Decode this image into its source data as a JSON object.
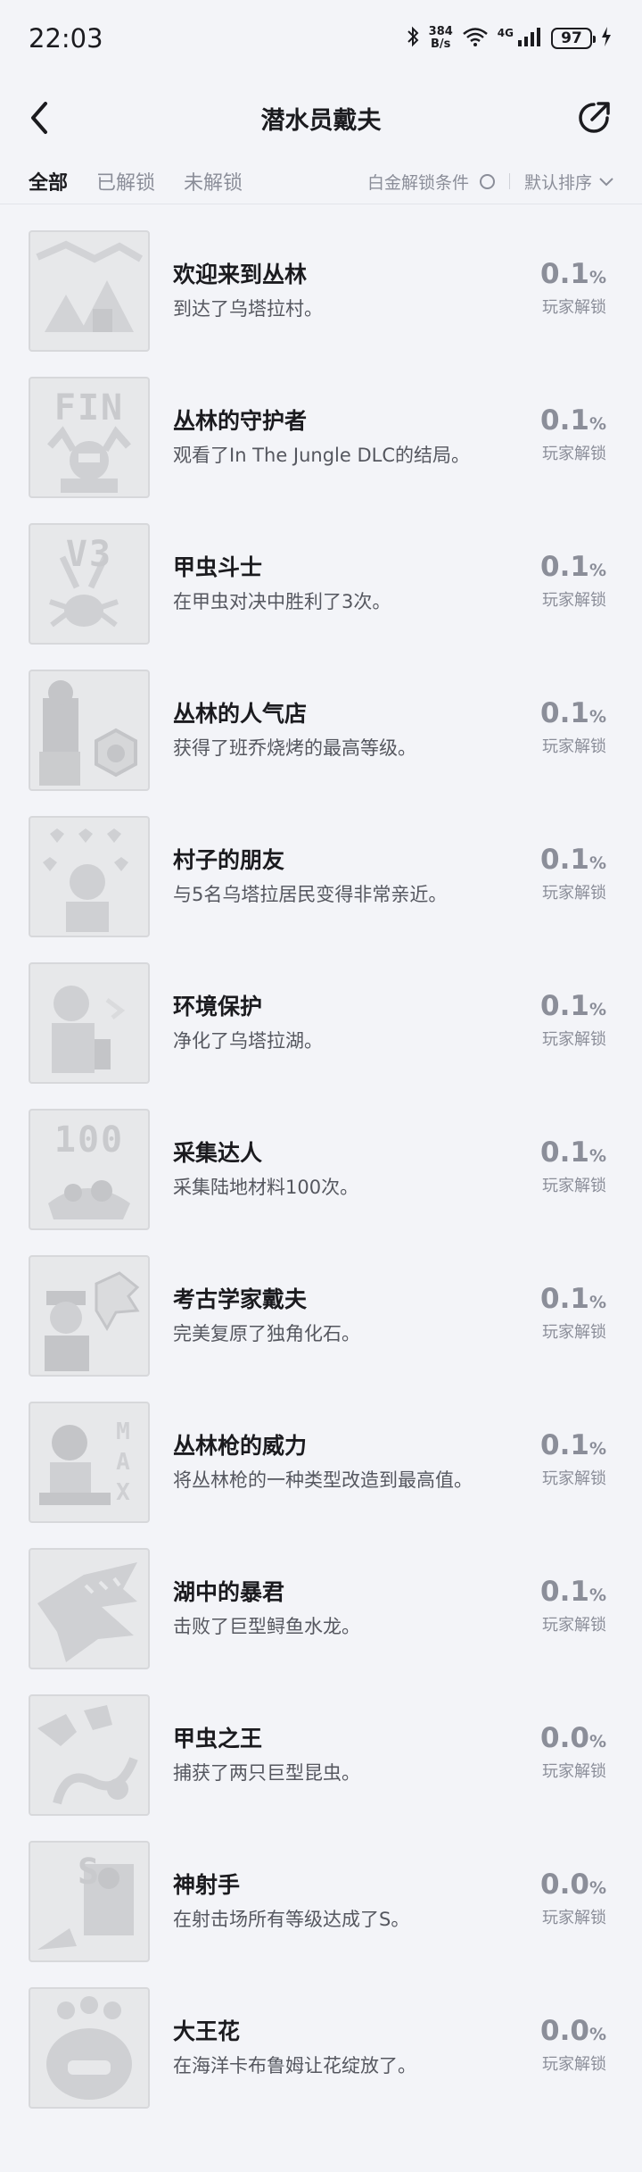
{
  "status_bar": {
    "time": "22:03",
    "speed_value": "384",
    "speed_unit": "B/s",
    "network": "4G",
    "battery": "97"
  },
  "header": {
    "title": "潜水员戴夫"
  },
  "filters": {
    "tabs": [
      "全部",
      "已解锁",
      "未解锁"
    ],
    "active_tab": "全部",
    "platinum_label": "白金解锁条件",
    "sort_label": "默认排序"
  },
  "unlock_label": "玩家解锁",
  "achievements": [
    {
      "name": "欢迎来到丛林",
      "desc": "到达了乌塔拉村。",
      "pct": "0.1",
      "icon": "village-icon",
      "badge": ""
    },
    {
      "name": "丛林的守护者",
      "desc": "观看了In The Jungle DLC的结局。",
      "pct": "0.1",
      "icon": "fin-guardian-icon",
      "badge": "FIN"
    },
    {
      "name": "甲虫斗士",
      "desc": "在甲虫对决中胜利了3次。",
      "pct": "0.1",
      "icon": "beetle-v3-icon",
      "badge": "V3"
    },
    {
      "name": "丛林的人气店",
      "desc": "获得了班乔烧烤的最高等级。",
      "pct": "0.1",
      "icon": "shop-level-icon",
      "badge": ""
    },
    {
      "name": "村子的朋友",
      "desc": "与5名乌塔拉居民变得非常亲近。",
      "pct": "0.1",
      "icon": "hearts-friend-icon",
      "badge": ""
    },
    {
      "name": "环境保护",
      "desc": "净化了乌塔拉湖。",
      "pct": "0.1",
      "icon": "environment-icon",
      "badge": ""
    },
    {
      "name": "采集达人",
      "desc": "采集陆地材料100次。",
      "pct": "0.1",
      "icon": "gather-100-icon",
      "badge": "100"
    },
    {
      "name": "考古学家戴夫",
      "desc": "完美复原了独角化石。",
      "pct": "0.1",
      "icon": "archaeologist-icon",
      "badge": ""
    },
    {
      "name": "丛林枪的威力",
      "desc": "将丛林枪的一种类型改造到最高值。",
      "pct": "0.1",
      "icon": "jungle-gun-max-icon",
      "badge": ""
    },
    {
      "name": "湖中的暴君",
      "desc": "击败了巨型鲟鱼水龙。",
      "pct": "0.1",
      "icon": "lake-tyrant-icon",
      "badge": ""
    },
    {
      "name": "甲虫之王",
      "desc": "捕获了两只巨型昆虫。",
      "pct": "0.0",
      "icon": "beetle-king-icon",
      "badge": ""
    },
    {
      "name": "神射手",
      "desc": "在射击场所有等级达成了S。",
      "pct": "0.0",
      "icon": "sharpshooter-icon",
      "badge": "S"
    },
    {
      "name": "大王花",
      "desc": "在海洋卡布鲁姆让花绽放了。",
      "pct": "0.0",
      "icon": "rafflesia-icon",
      "badge": ""
    }
  ],
  "colors": {
    "background": "#f3f4f8",
    "text_primary": "#1b1b1f",
    "text_muted": "#8b8e99",
    "thumb_bg": "#e7e8ea"
  }
}
